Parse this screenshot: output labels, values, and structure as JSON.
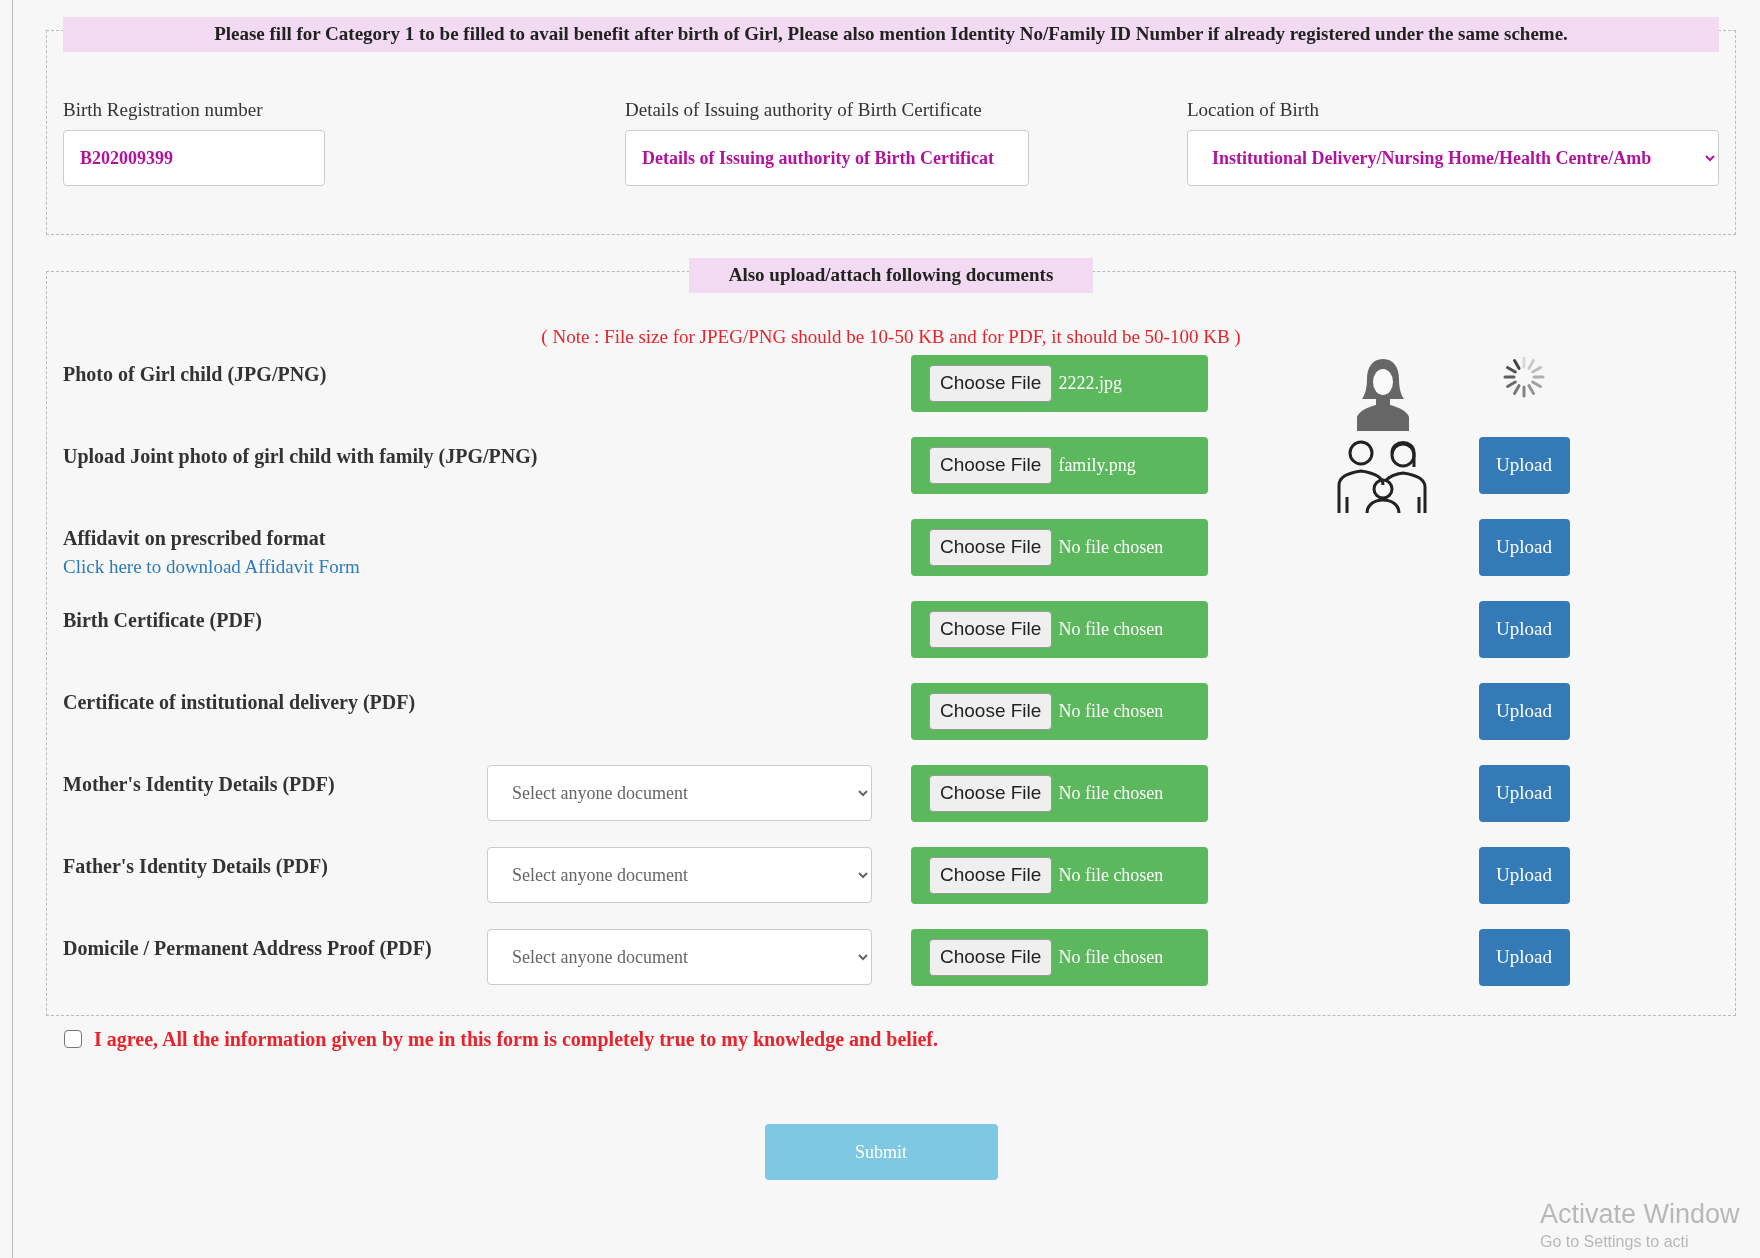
{
  "category_section": {
    "legend": "Please fill for Category 1 to be filled to avail benefit after birth of Girl, Please also mention Identity No/Family ID Number if already registered under the same scheme.",
    "fields": [
      {
        "kind": "input",
        "label": "Birth Registration number",
        "value": "B202009399"
      },
      {
        "kind": "input",
        "label": "Details of Issuing authority of Birth Certificate",
        "value": "Details of Issuing authority of Birth Certificat"
      },
      {
        "kind": "select",
        "label": "Location of Birth",
        "value": "Institutional Delivery/Nursing Home/Health Centre/Amb"
      }
    ]
  },
  "documents_section": {
    "legend": "Also upload/attach following documents",
    "note": "( Note : File size for JPEG/PNG should be 10-50 KB and for PDF, it should be 50-100 KB )",
    "rows": [
      {
        "label": "Photo of Girl child (JPG/PNG)",
        "choose": "Choose File",
        "file": "2222.jpg",
        "preview": {
          "kind": "girl"
        },
        "action": {
          "kind": "spinner"
        }
      },
      {
        "label": "Upload Joint photo of girl child with family (JPG/PNG)",
        "choose": "Choose File",
        "file": "family.png",
        "preview": {
          "kind": "family"
        },
        "action": {
          "kind": "upload",
          "label": "Upload"
        }
      },
      {
        "label": "Affidavit on prescribed format",
        "link": "Click here to download Affidavit Form",
        "choose": "Choose File",
        "file": "No file chosen",
        "action": {
          "kind": "upload",
          "label": "Upload"
        }
      },
      {
        "label": "Birth Certificate (PDF)",
        "choose": "Choose File",
        "file": "No file chosen",
        "action": {
          "kind": "upload",
          "label": "Upload"
        }
      },
      {
        "label": "Certificate of institutional delivery (PDF)",
        "choose": "Choose File",
        "file": "No file chosen",
        "action": {
          "kind": "upload",
          "label": "Upload"
        }
      },
      {
        "label": "Mother's Identity Details (PDF)",
        "select": "Select anyone document",
        "choose": "Choose File",
        "file": "No file chosen",
        "action": {
          "kind": "upload",
          "label": "Upload"
        }
      },
      {
        "label": "Father's Identity Details (PDF)",
        "select": "Select anyone document",
        "choose": "Choose File",
        "file": "No file chosen",
        "action": {
          "kind": "upload",
          "label": "Upload"
        }
      },
      {
        "label": "Domicile / Permanent Address Proof (PDF)",
        "select": "Select anyone document",
        "choose": "Choose File",
        "file": "No file chosen",
        "action": {
          "kind": "upload",
          "label": "Upload"
        }
      }
    ]
  },
  "agreement": {
    "checked": false,
    "text": "I agree, All the information given by me in this form is completely true to my knowledge and belief."
  },
  "submit": "Submit",
  "os_overlay": {
    "title": "Activate Window",
    "subtitle": "Go to Settings to acti"
  }
}
